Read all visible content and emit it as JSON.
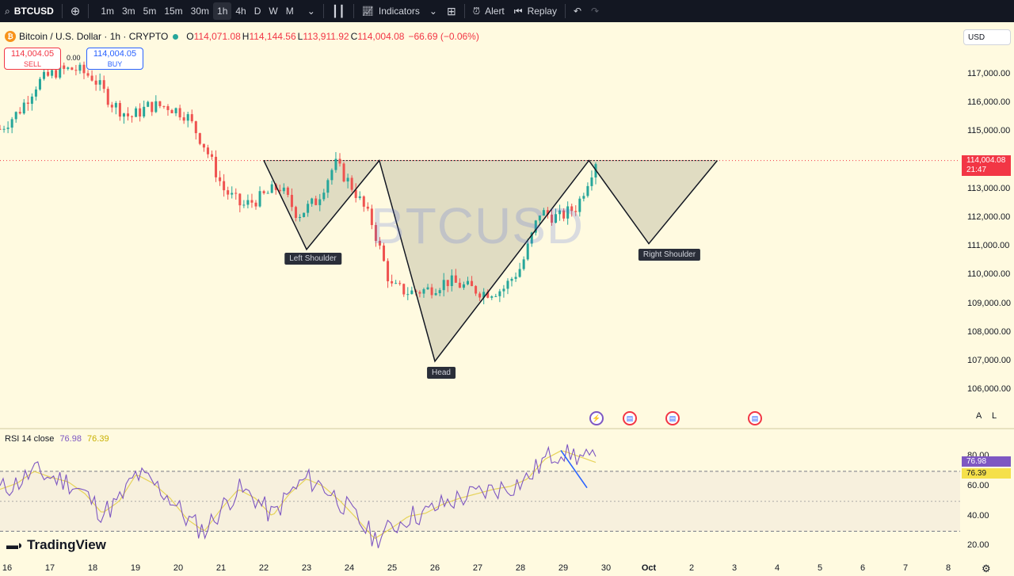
{
  "toolbar": {
    "symbol": "BTCUSD",
    "timeframes": [
      "1m",
      "3m",
      "5m",
      "15m",
      "30m",
      "1h",
      "4h",
      "D",
      "W",
      "M"
    ],
    "active_timeframe": "1h",
    "indicators_label": "Indicators",
    "alert_label": "Alert",
    "replay_label": "Replay"
  },
  "legend": {
    "title": "Bitcoin / U.S. Dollar · 1h · CRYPTO",
    "o_label": "O",
    "o": "114,071.08",
    "h_label": "H",
    "h": "114,144.56",
    "l_label": "L",
    "l": "113,911.92",
    "c_label": "C",
    "c": "114,004.08",
    "change": "−66.69 (−0.06%)"
  },
  "trade": {
    "sell_price": "114,004.05",
    "sell_label": "SELL",
    "buy_price": "114,004.05",
    "buy_label": "BUY",
    "spread": "0.00"
  },
  "currency": "USD",
  "watermark": "BTCUSD",
  "price_axis": {
    "ticks": [
      "117,000.00",
      "116,000.00",
      "115,000.00",
      "113,000.00",
      "112,000.00",
      "111,000.00",
      "110,000.00",
      "109,000.00",
      "108,000.00",
      "107,000.00",
      "106,000.00"
    ],
    "last_price": "114,004.08",
    "countdown": "21:47"
  },
  "pattern": {
    "left_shoulder": "Left Shoulder",
    "head": "Head",
    "right_shoulder": "Right Shoulder"
  },
  "rsi": {
    "label": "RSI 14 close",
    "value": "76.98",
    "ma_value": "76.39",
    "ticks": [
      "80.00",
      "60.00",
      "40.00",
      "20.00"
    ]
  },
  "time_axis": [
    "16",
    "17",
    "18",
    "19",
    "20",
    "21",
    "22",
    "23",
    "24",
    "25",
    "26",
    "27",
    "28",
    "29",
    "30",
    "Oct",
    "2",
    "3",
    "4",
    "5",
    "6",
    "7",
    "8"
  ],
  "scale_buttons": [
    "A",
    "L"
  ],
  "branding": "TradingView",
  "colors": {
    "up": "#26a69a",
    "down": "#ef5350",
    "rsi": "#7e57c2",
    "rsi_ma": "#e6d35a",
    "pattern_fill": "#d6d2b8"
  },
  "chart_data": {
    "type": "candlestick",
    "title": "Bitcoin / U.S. Dollar · 1h · CRYPTO",
    "ylim": [
      105500,
      117700
    ],
    "x": [
      "16",
      "17",
      "18",
      "19",
      "20",
      "21",
      "22",
      "23",
      "24",
      "25",
      "26",
      "27",
      "28",
      "29",
      "30"
    ],
    "close_path": [
      115100,
      115700,
      116700,
      117100,
      117200,
      116900,
      116000,
      115500,
      115900,
      115900,
      115600,
      114500,
      113000,
      112400,
      112700,
      113100,
      112100,
      112600,
      113900,
      113000,
      111800,
      109600,
      109400,
      109500,
      109800,
      109600,
      109400,
      109500,
      110300,
      112200,
      112000,
      112400,
      114000
    ],
    "head_and_shoulders": [
      {
        "x": "22",
        "y": 114000
      },
      {
        "x": "23",
        "y": 110900
      },
      {
        "x": "24.7",
        "y": 114000
      },
      {
        "x": "26",
        "y": 107000
      },
      {
        "x": "29.6",
        "y": 114000
      },
      {
        "x": "Oct",
        "y": 111100
      },
      {
        "x": "2.6",
        "y": 114000
      }
    ],
    "neckline": 114000,
    "rsi_series": {
      "name": "RSI 14 close",
      "values": [
        58,
        62,
        70,
        66,
        63,
        55,
        42,
        50,
        68,
        62,
        52,
        38,
        30,
        45,
        58,
        52,
        40,
        55,
        65,
        60,
        50,
        38,
        25,
        32,
        40,
        42,
        48,
        52,
        55,
        58,
        60,
        65,
        78,
        84,
        80,
        76
      ]
    },
    "rsi_ylim": [
      15,
      90
    ],
    "rsi_levels": [
      70,
      50,
      30
    ]
  }
}
